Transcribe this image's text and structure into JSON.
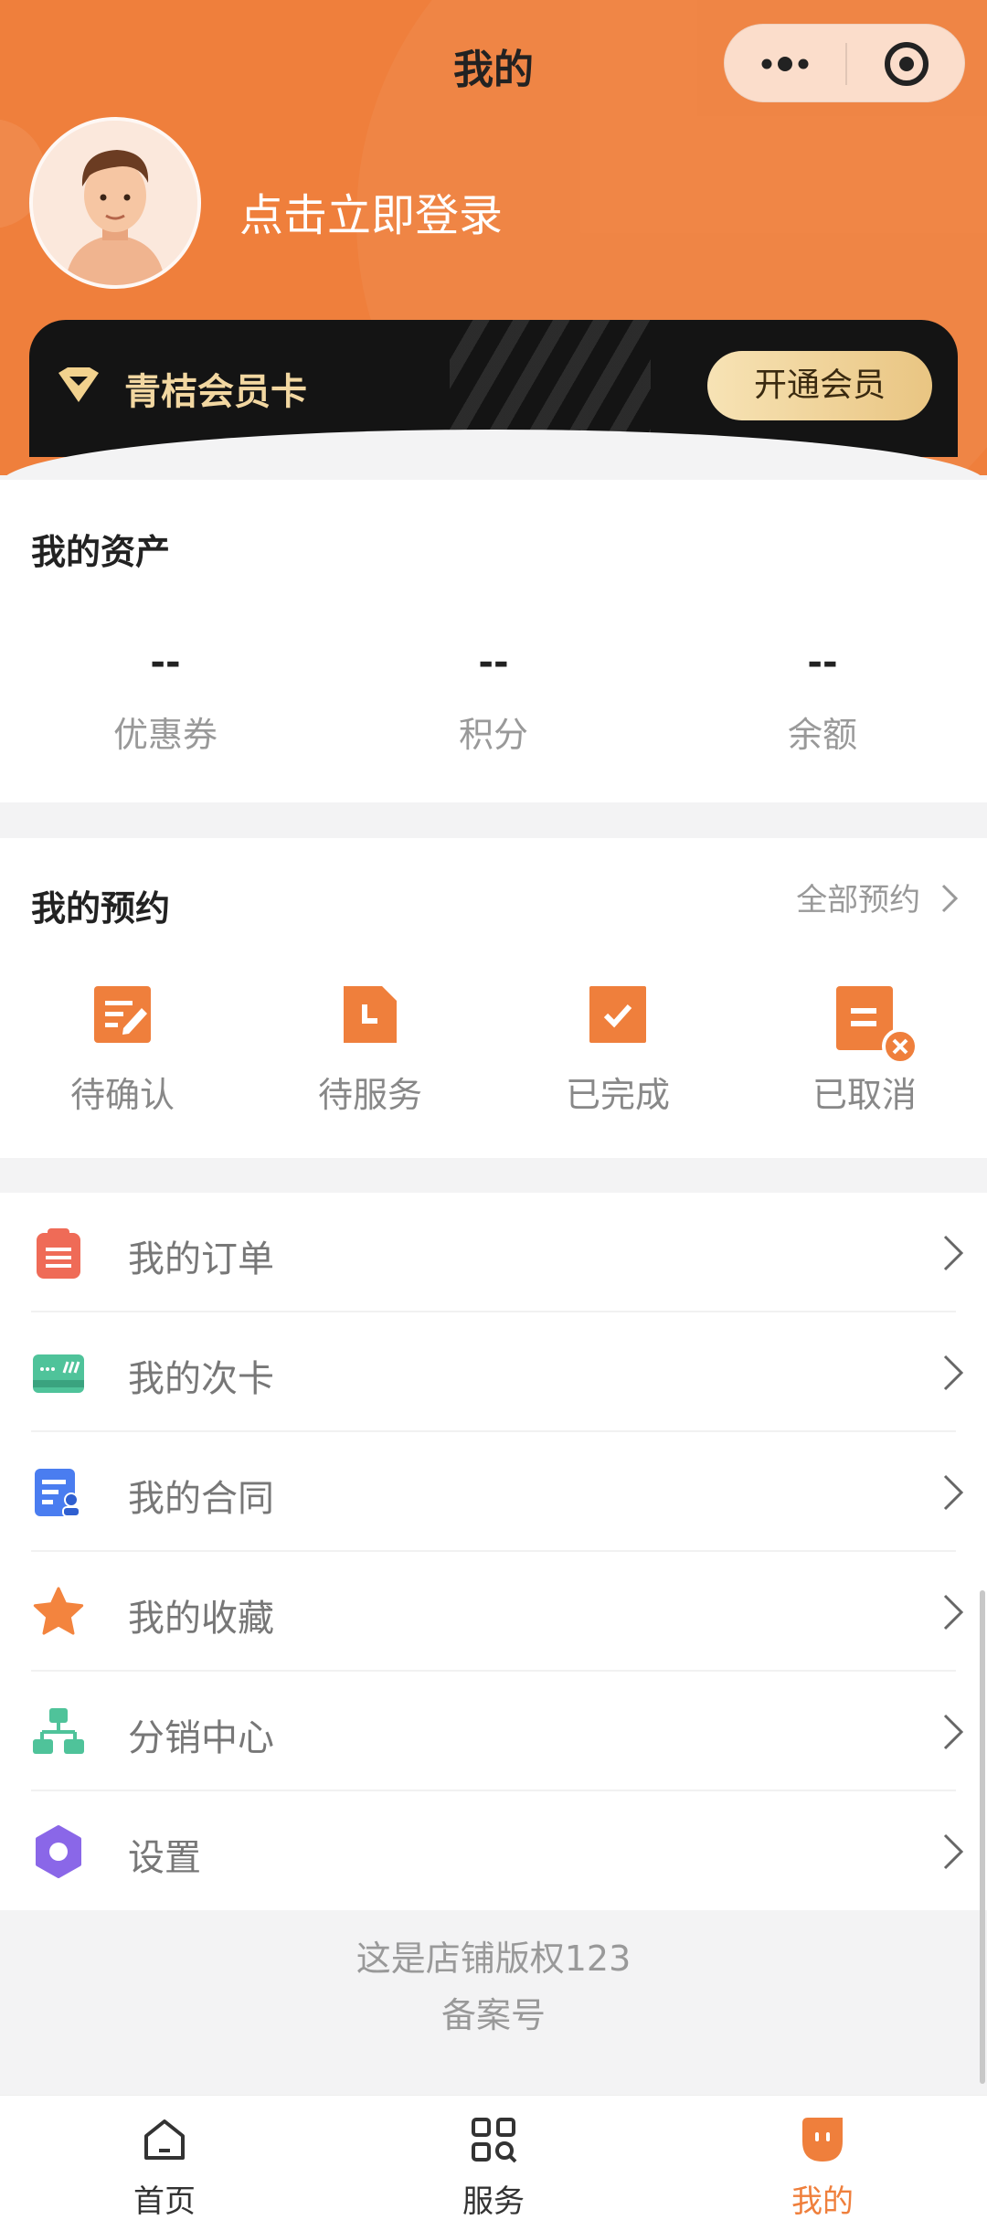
{
  "header": {
    "title": "我的",
    "login_prompt": "点击立即登录"
  },
  "vip": {
    "name": "青桔会员卡",
    "button": "开通会员"
  },
  "assets": {
    "title": "我的资产",
    "items": [
      {
        "value": "--",
        "label": "优惠券"
      },
      {
        "value": "--",
        "label": "积分"
      },
      {
        "value": "--",
        "label": "余额"
      }
    ]
  },
  "reservations": {
    "title": "我的预约",
    "all_link": "全部预约",
    "items": [
      {
        "label": "待确认",
        "icon": "edit-document-icon"
      },
      {
        "label": "待服务",
        "icon": "pending-document-icon"
      },
      {
        "label": "已完成",
        "icon": "check-document-icon"
      },
      {
        "label": "已取消",
        "icon": "cancel-document-icon"
      }
    ]
  },
  "menu": {
    "items": [
      {
        "label": "我的订单",
        "icon": "order-list-icon",
        "color": "#ef6b57"
      },
      {
        "label": "我的次卡",
        "icon": "card-icon",
        "color": "#4fc39a"
      },
      {
        "label": "我的合同",
        "icon": "contract-icon",
        "color": "#4a7df0"
      },
      {
        "label": "我的收藏",
        "icon": "star-icon",
        "color": "#f3843e"
      },
      {
        "label": "分销中心",
        "icon": "org-chart-icon",
        "color": "#4fc39a"
      },
      {
        "label": "设置",
        "icon": "settings-hexagon-icon",
        "color": "#8a67e8"
      }
    ]
  },
  "footer": {
    "copyright": "这是店铺版权123",
    "record": "备案号"
  },
  "tabbar": {
    "items": [
      {
        "label": "首页",
        "icon": "home-icon",
        "active": false
      },
      {
        "label": "服务",
        "icon": "services-grid-icon",
        "active": false
      },
      {
        "label": "我的",
        "icon": "profile-face-icon",
        "active": true
      }
    ]
  },
  "colors": {
    "accent": "#ef7f3c",
    "vip_gold": "#f2d7a1",
    "vip_card_bg": "#141414"
  }
}
